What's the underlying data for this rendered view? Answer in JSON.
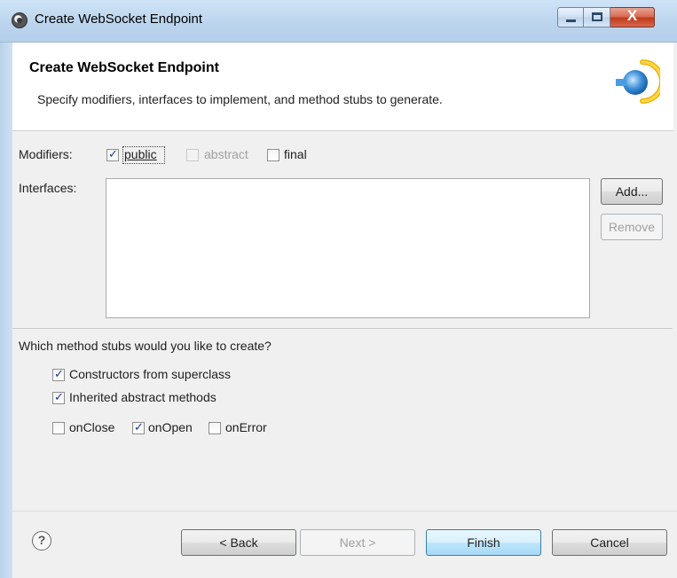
{
  "window": {
    "title": "Create WebSocket Endpoint",
    "icon": "eclipse-app-icon",
    "controls": {
      "minimize": "minimize-icon",
      "maximize": "maximize-icon",
      "close_label": "X"
    }
  },
  "header": {
    "title": "Create WebSocket Endpoint",
    "description": "Specify modifiers, interfaces to implement, and method stubs to generate.",
    "icon": "websocket-wizard-icon"
  },
  "modifiers": {
    "label": "Modifiers:",
    "options": [
      {
        "label": "public",
        "checked": true,
        "enabled": true
      },
      {
        "label": "abstract",
        "checked": false,
        "enabled": false
      },
      {
        "label": "final",
        "checked": false,
        "enabled": true
      }
    ]
  },
  "interfaces": {
    "label": "Interfaces:",
    "items": [],
    "add_label": "Add...",
    "remove_label": "Remove"
  },
  "stubs": {
    "question": "Which method stubs would you like to create?",
    "options": [
      {
        "label": "Constructors from superclass",
        "checked": true
      },
      {
        "label": "Inherited abstract methods",
        "checked": true
      },
      {
        "label": "onClose",
        "checked": false
      },
      {
        "label": "onOpen",
        "checked": true
      },
      {
        "label": "onError",
        "checked": false
      }
    ]
  },
  "footer": {
    "help_label": "?",
    "back_label": "< Back",
    "next_label": "Next >",
    "finish_label": "Finish",
    "cancel_label": "Cancel"
  },
  "colors": {
    "accent_blue": "#3c7fb1",
    "checkmark": "#1b3a8a",
    "close_red": "#c0381a"
  }
}
